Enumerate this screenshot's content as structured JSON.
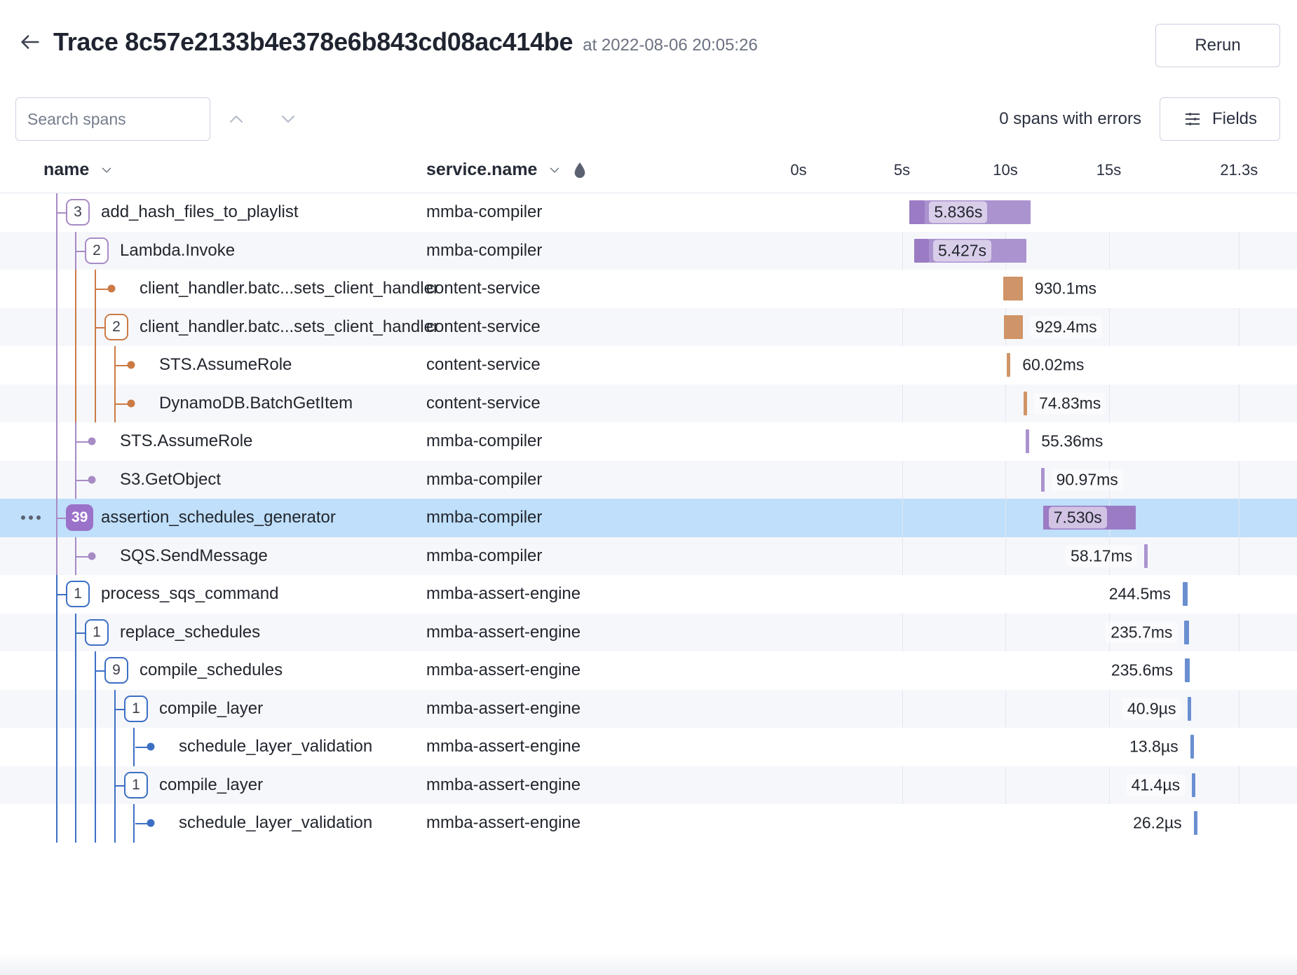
{
  "header": {
    "back_icon": "arrow-left-icon",
    "title": "Trace 8c57e2133b4e378e6b843cd08ac414be",
    "timestamp": "at 2022-08-06 20:05:26",
    "rerun_label": "Rerun"
  },
  "toolbar": {
    "search_placeholder": "Search spans",
    "search_value": "",
    "prev_icon": "chevron-up-icon",
    "next_icon": "chevron-down-icon",
    "errors_text": "0 spans with errors",
    "fields_label": "Fields",
    "fields_icon": "sliders-icon"
  },
  "columns": {
    "name_label": "name",
    "name_sort_icon": "chevron-down-icon",
    "service_label": "service.name",
    "service_sort_icon": "chevron-down-icon",
    "service_filter_icon": "droplet-icon"
  },
  "timeline_axis": {
    "ticks": [
      "0s",
      "5s",
      "10s",
      "15s",
      "21.3s"
    ],
    "total_label": "21.3s",
    "duration_seconds": 21.3
  },
  "colors": {
    "purple": "#ab93cf",
    "purple_dark": "#9b7bc4",
    "orange": "#cf9468",
    "blue": "#6a8fd1",
    "selected_row": "#bfdffa",
    "alt_row": "#f6f7fb",
    "badge_filled": "#9b72c9"
  },
  "rows": [
    {
      "name": "add_hash_files_to_playlist",
      "service": "mmba-compiler",
      "duration": "5.836s",
      "depth": 1,
      "marker": "badge",
      "badge": "3",
      "color": "purple",
      "bar": {
        "start_pct": 25.2,
        "width_pct": 27.4,
        "self_pct": 3.5,
        "label_side": "inside"
      },
      "alt": false,
      "selected": false,
      "dots": false
    },
    {
      "name": "Lambda.Invoke",
      "service": "mmba-compiler",
      "duration": "5.427s",
      "depth": 2,
      "marker": "badge",
      "badge": "2",
      "color": "purple",
      "bar": {
        "start_pct": 26.2,
        "width_pct": 25.5,
        "self_pct": 3.4,
        "label_side": "inside"
      },
      "alt": true,
      "selected": false,
      "dots": false
    },
    {
      "name": "client_handler.batc...sets_client_handler",
      "service": "content-service",
      "duration": "930.1ms",
      "depth": 3,
      "marker": "dot",
      "badge": "",
      "color": "orange",
      "bar": {
        "start_pct": 46.5,
        "width_pct": 4.4,
        "self_pct": 0,
        "label_side": "right"
      },
      "alt": false,
      "selected": false,
      "dots": false
    },
    {
      "name": "client_handler.batc...sets_client_handler",
      "service": "content-service",
      "duration": "929.4ms",
      "depth": 3,
      "marker": "badge",
      "badge": "2",
      "color": "orange",
      "bar": {
        "start_pct": 46.6,
        "width_pct": 4.4,
        "self_pct": 0,
        "label_side": "right"
      },
      "alt": true,
      "selected": false,
      "dots": false
    },
    {
      "name": "STS.AssumeRole",
      "service": "content-service",
      "duration": "60.02ms",
      "depth": 4,
      "marker": "dot",
      "badge": "",
      "color": "orange",
      "bar": {
        "start_pct": 47.3,
        "width_pct": 0.45,
        "self_pct": 0,
        "label_side": "right"
      },
      "alt": false,
      "selected": false,
      "dots": false
    },
    {
      "name": "DynamoDB.BatchGetItem",
      "service": "content-service",
      "duration": "74.83ms",
      "depth": 4,
      "marker": "dot",
      "badge": "",
      "color": "orange",
      "bar": {
        "start_pct": 51.1,
        "width_pct": 0.5,
        "self_pct": 0,
        "label_side": "right"
      },
      "alt": true,
      "selected": false,
      "dots": false
    },
    {
      "name": "STS.AssumeRole",
      "service": "mmba-compiler",
      "duration": "55.36ms",
      "depth": 2,
      "marker": "dot",
      "badge": "",
      "color": "purple",
      "bar": {
        "start_pct": 51.6,
        "width_pct": 0.3,
        "self_pct": 0,
        "label_side": "right"
      },
      "alt": false,
      "selected": false,
      "dots": false
    },
    {
      "name": "S3.GetObject",
      "service": "mmba-compiler",
      "duration": "90.97ms",
      "depth": 2,
      "marker": "dot",
      "badge": "",
      "color": "purple",
      "bar": {
        "start_pct": 55.0,
        "width_pct": 0.42,
        "self_pct": 0,
        "label_side": "right"
      },
      "alt": true,
      "selected": false,
      "dots": false
    },
    {
      "name": "assertion_schedules_generator",
      "service": "mmba-compiler",
      "duration": "7.530s",
      "depth": 1,
      "marker": "badge-filled",
      "badge": "39",
      "color": "purple",
      "bar": {
        "start_pct": 55.5,
        "width_pct": 21.0,
        "self_pct": 0,
        "label_side": "inside-left"
      },
      "alt": false,
      "selected": true,
      "dots": true
    },
    {
      "name": "SQS.SendMessage",
      "service": "mmba-compiler",
      "duration": "58.17ms",
      "depth": 2,
      "marker": "dot",
      "badge": "",
      "color": "purple",
      "bar": {
        "start_pct": 78.5,
        "width_pct": 0.3,
        "self_pct": 0,
        "label_side": "left"
      },
      "alt": true,
      "selected": false,
      "dots": false
    },
    {
      "name": "process_sqs_command",
      "service": "mmba-assert-engine",
      "duration": "244.5ms",
      "depth": 1,
      "marker": "badge",
      "badge": "1",
      "color": "blue",
      "bar": {
        "start_pct": 87.2,
        "width_pct": 1.1,
        "self_pct": 0,
        "label_side": "left"
      },
      "alt": false,
      "selected": false,
      "dots": false
    },
    {
      "name": "replace_schedules",
      "service": "mmba-assert-engine",
      "duration": "235.7ms",
      "depth": 2,
      "marker": "badge",
      "badge": "1",
      "color": "blue",
      "bar": {
        "start_pct": 87.6,
        "width_pct": 1.1,
        "self_pct": 0,
        "label_side": "left"
      },
      "alt": true,
      "selected": false,
      "dots": false
    },
    {
      "name": "compile_schedules",
      "service": "mmba-assert-engine",
      "duration": "235.6ms",
      "depth": 3,
      "marker": "badge",
      "badge": "9",
      "color": "blue",
      "bar": {
        "start_pct": 87.7,
        "width_pct": 1.1,
        "self_pct": 0,
        "label_side": "left"
      },
      "alt": false,
      "selected": false,
      "dots": false
    },
    {
      "name": "compile_layer",
      "service": "mmba-assert-engine",
      "duration": "40.9µs",
      "depth": 4,
      "marker": "badge",
      "badge": "1",
      "color": "blue",
      "bar": {
        "start_pct": 88.4,
        "width_pct": 0.26,
        "self_pct": 0,
        "label_side": "left"
      },
      "alt": true,
      "selected": false,
      "dots": false
    },
    {
      "name": "schedule_layer_validation",
      "service": "mmba-assert-engine",
      "duration": "13.8µs",
      "depth": 5,
      "marker": "dot",
      "badge": "",
      "color": "blue",
      "bar": {
        "start_pct": 88.9,
        "width_pct": 0.26,
        "self_pct": 0,
        "label_side": "left"
      },
      "alt": false,
      "selected": false,
      "dots": false
    },
    {
      "name": "compile_layer",
      "service": "mmba-assert-engine",
      "duration": "41.4µs",
      "depth": 4,
      "marker": "badge",
      "badge": "1",
      "color": "blue",
      "bar": {
        "start_pct": 89.3,
        "width_pct": 0.26,
        "self_pct": 0,
        "label_side": "left"
      },
      "alt": true,
      "selected": false,
      "dots": false
    },
    {
      "name": "schedule_layer_validation",
      "service": "mmba-assert-engine",
      "duration": "26.2µs",
      "depth": 5,
      "marker": "dot",
      "badge": "",
      "color": "blue",
      "bar": {
        "start_pct": 89.7,
        "width_pct": 0.26,
        "self_pct": 0,
        "label_side": "left"
      },
      "alt": false,
      "selected": false,
      "dots": false
    }
  ]
}
